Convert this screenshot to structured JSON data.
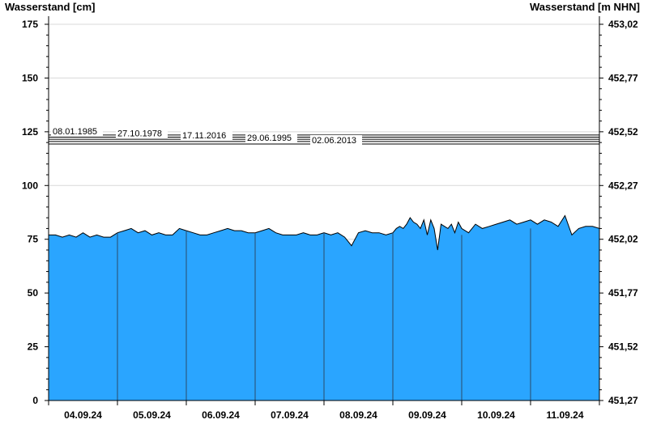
{
  "chart_data": {
    "type": "area",
    "ylabel_left": "Wasserstand [cm]",
    "ylabel_right": "Wasserstand [m NHN]",
    "ylim": [
      0,
      175
    ],
    "yticks_left": [
      "0",
      "25",
      "50",
      "75",
      "100",
      "125",
      "150",
      "175"
    ],
    "yticks_right": [
      "451,27",
      "451,52",
      "451,77",
      "452,02",
      "452,27",
      "452,52",
      "452,77",
      "453,02"
    ],
    "x_categories": [
      "04.09.24",
      "05.09.24",
      "06.09.24",
      "07.09.24",
      "08.09.24",
      "09.09.24",
      "10.09.24",
      "11.09.24"
    ],
    "grid": true,
    "colors": {
      "fill": "#2AA5FF",
      "line": "#000000",
      "grid": "#d8d8d8"
    },
    "reference_levels": [
      {
        "label": "08.01.1985",
        "value": 123.5
      },
      {
        "label": "27.10.1978",
        "value": 122.5
      },
      {
        "label": "17.11.2016",
        "value": 121.5
      },
      {
        "label": "29.06.1995",
        "value": 120.5
      },
      {
        "label": "02.06.2013",
        "value": 119.3
      }
    ],
    "series": [
      {
        "x": [
          0,
          0.1,
          0.2,
          0.3,
          0.4,
          0.5,
          0.6,
          0.7,
          0.8,
          0.9,
          1,
          1.1,
          1.2,
          1.3,
          1.4,
          1.5,
          1.6,
          1.7,
          1.8,
          1.9,
          2,
          2.1,
          2.2,
          2.3,
          2.4,
          2.5,
          2.6,
          2.7,
          2.8,
          2.9,
          3,
          3.1,
          3.2,
          3.3,
          3.4,
          3.5,
          3.6,
          3.7,
          3.8,
          3.9,
          4,
          4.1,
          4.2,
          4.3,
          4.4,
          4.5,
          4.6,
          4.7,
          4.8,
          4.9,
          5,
          5.05,
          5.1,
          5.15,
          5.2,
          5.25,
          5.3,
          5.35,
          5.4,
          5.45,
          5.5,
          5.55,
          5.6,
          5.65,
          5.7,
          5.75,
          5.8,
          5.85,
          5.9,
          5.95,
          6,
          6.1,
          6.2,
          6.3,
          6.4,
          6.5,
          6.6,
          6.7,
          6.8,
          6.9,
          7,
          7.1,
          7.2,
          7.3,
          7.4,
          7.5,
          7.6,
          7.7,
          7.8,
          7.9,
          8
        ],
        "values": [
          77,
          77,
          76,
          77,
          76,
          78,
          76,
          77,
          76,
          76,
          78,
          79,
          80,
          78,
          79,
          77,
          78,
          77,
          77,
          80,
          79,
          78,
          77,
          77,
          78,
          79,
          80,
          79,
          79,
          78,
          78,
          79,
          80,
          78,
          77,
          77,
          77,
          78,
          77,
          77,
          78,
          77,
          78,
          76,
          72,
          78,
          79,
          78,
          78,
          77,
          78,
          80,
          81,
          80,
          82,
          85,
          83,
          82,
          80,
          84,
          77,
          84,
          80,
          70,
          82,
          81,
          80,
          82,
          78,
          83,
          80,
          78,
          82,
          80,
          81,
          82,
          83,
          84,
          82,
          83,
          84,
          82,
          84,
          83,
          81,
          86,
          77,
          80,
          81,
          81,
          80
        ]
      }
    ]
  }
}
